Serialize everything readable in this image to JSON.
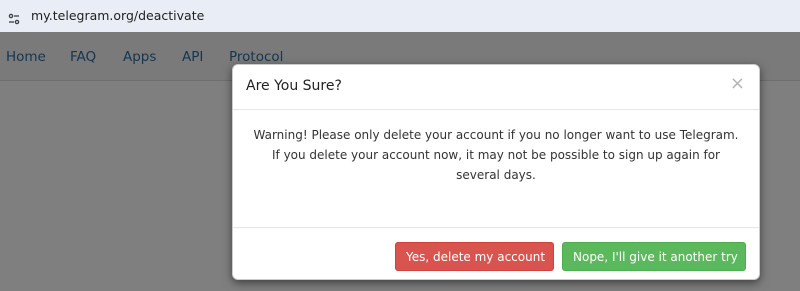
{
  "browser": {
    "url": "my.telegram.org/deactivate",
    "site_info_icon": "tune-icon"
  },
  "nav": {
    "items": [
      "Home",
      "FAQ",
      "Apps",
      "API",
      "Protocol"
    ]
  },
  "modal": {
    "title": "Are You Sure?",
    "close_label": "×",
    "body_text": "Warning! Please only delete your account if you no longer want to use Telegram. If you delete your account now, it may not be possible to sign up again for several days.",
    "confirm_label": "Yes, delete my account",
    "cancel_label": "Nope, I'll give it another try"
  },
  "colors": {
    "danger": "#d9534f",
    "success": "#5cb85c",
    "nav_link": "#2d6ea3",
    "overlay": "rgba(0,0,0,0.5)"
  }
}
